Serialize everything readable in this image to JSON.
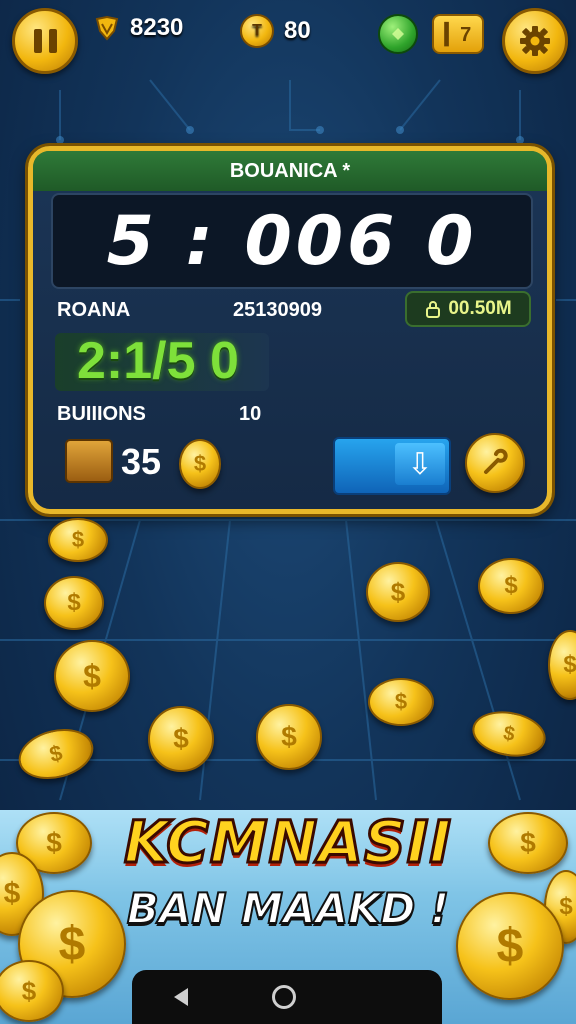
{
  "topbar": {
    "currency1": "8230",
    "currency2": "80",
    "shop_label": "▎7"
  },
  "panel": {
    "title": "BOUANICA *",
    "display": "5 : 006 0",
    "row1_label": "ROANA",
    "row1_value": "25130909",
    "timer": "00.50M",
    "score": "2:1/5 0",
    "row2_label": "BUIIIONS",
    "row2_value": "10",
    "chest_count": "35"
  },
  "banner": {
    "title": "KCMNASII",
    "subtitle": "BAN MAAKD !"
  },
  "colors": {
    "gold": "#f2b70f",
    "panel_border": "#e8b82a",
    "header_green": "#2f7a38",
    "score_green": "#7ee03a",
    "accent_blue": "#0f64b8",
    "banner_red": "#b3210a"
  },
  "icons": [
    "pause-icon",
    "shield-gem-icon",
    "coin-t-icon",
    "green-gem-icon",
    "gear-icon",
    "lock-icon",
    "chest-icon",
    "download-arrow-icon",
    "wrench-icon",
    "dollar-coin-icon",
    "back-icon",
    "home-icon"
  ]
}
